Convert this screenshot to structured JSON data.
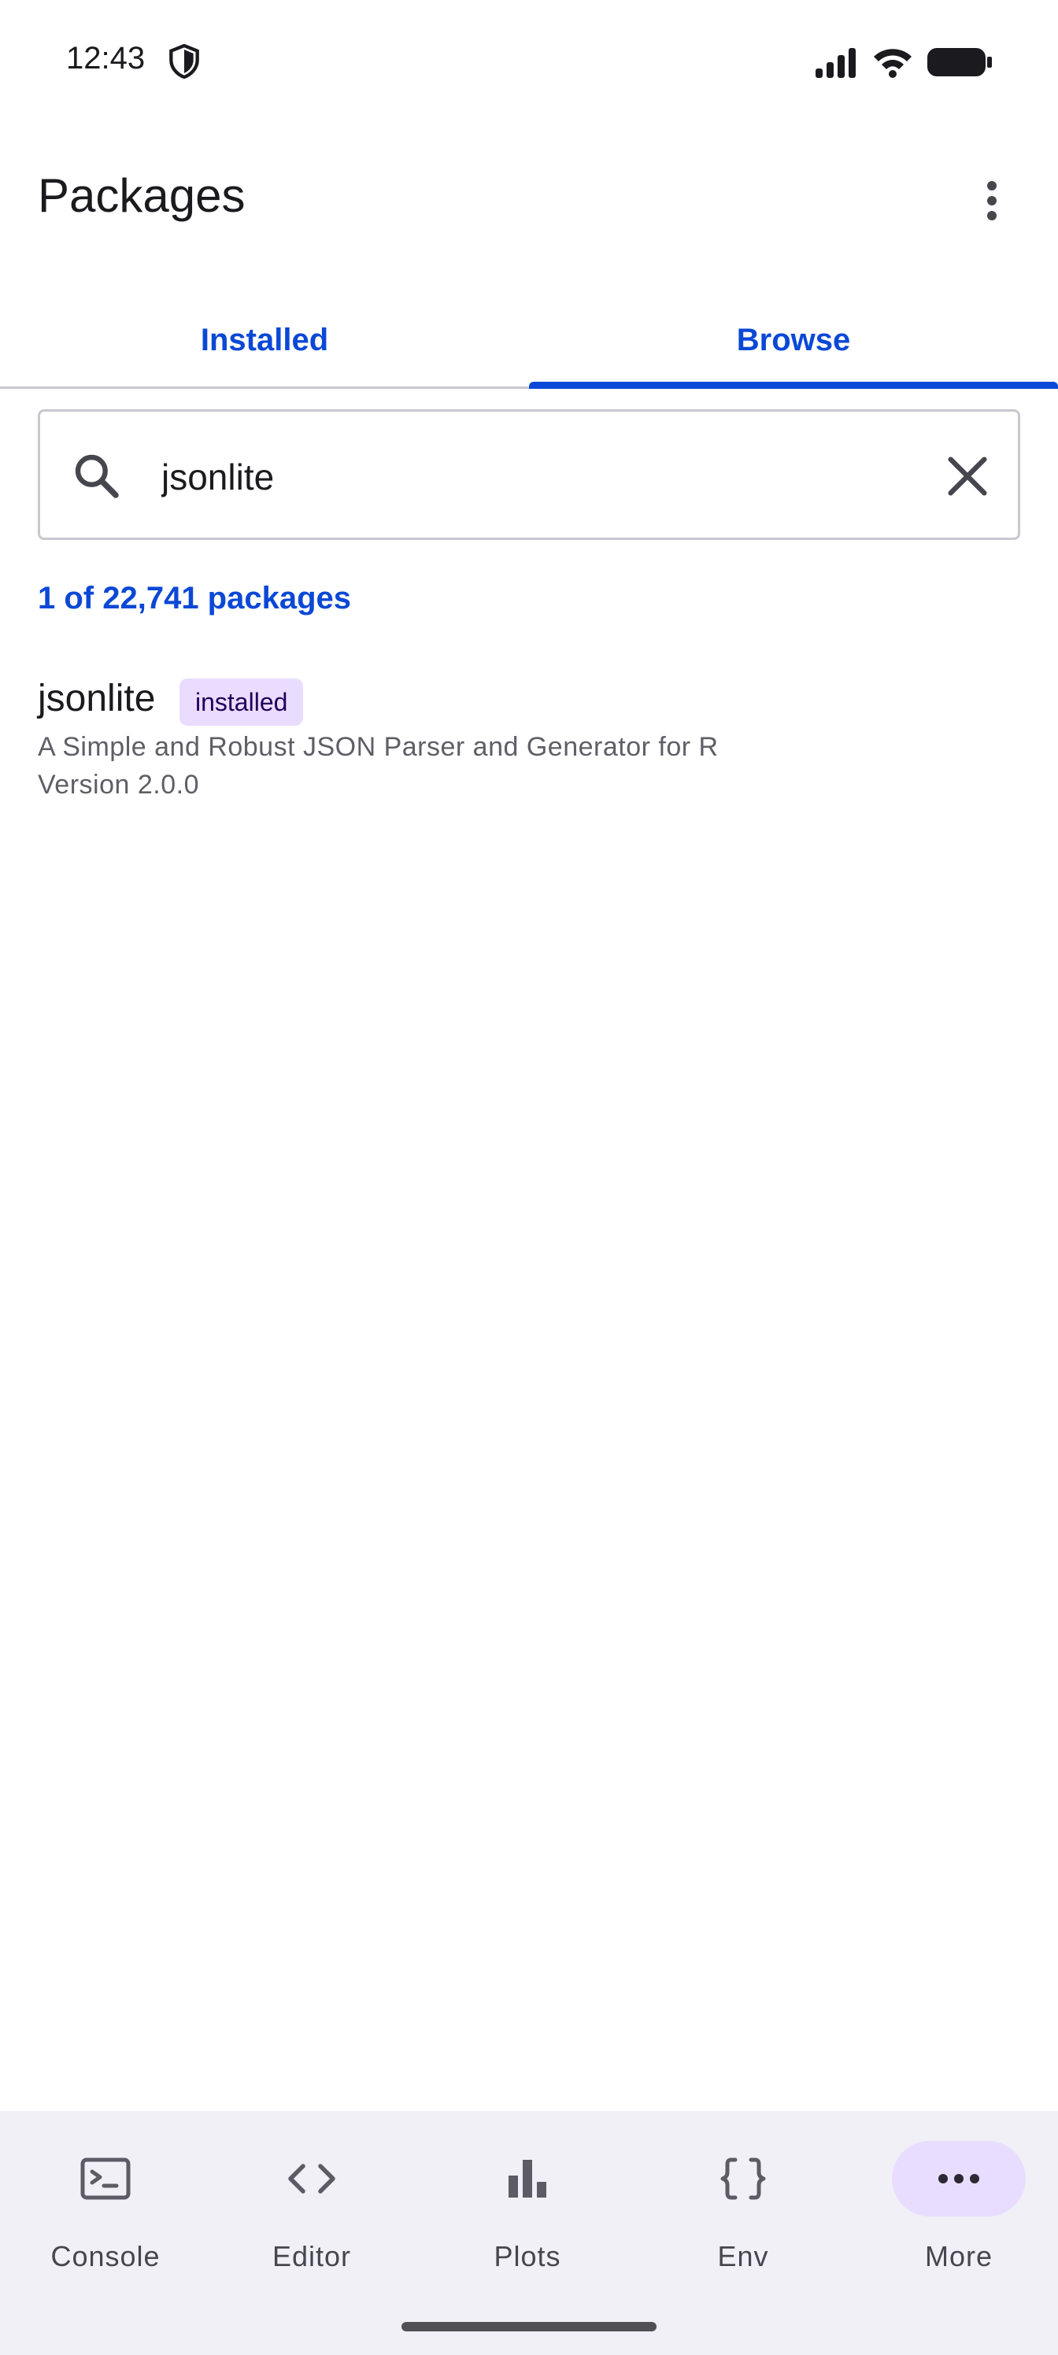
{
  "status_bar": {
    "time": "12:43"
  },
  "header": {
    "title": "Packages"
  },
  "tabs": [
    {
      "label": "Installed",
      "selected": false
    },
    {
      "label": "Browse",
      "selected": true
    }
  ],
  "search": {
    "value": "jsonlite",
    "placeholder": ""
  },
  "results": {
    "count_text": "1 of 22,741 packages",
    "items": [
      {
        "name": "jsonlite",
        "badge": "installed",
        "description": "A Simple and Robust JSON Parser and Generator for R",
        "version": "Version 2.0.0"
      }
    ]
  },
  "bottom_nav": {
    "items": [
      {
        "label": "Console",
        "icon": "console-icon"
      },
      {
        "label": "Editor",
        "icon": "code-icon"
      },
      {
        "label": "Plots",
        "icon": "bar-chart-icon"
      },
      {
        "label": "Env",
        "icon": "braces-icon"
      },
      {
        "label": "More",
        "icon": "more-horizontal-icon",
        "active": true
      }
    ]
  },
  "colors": {
    "accent": "#0b48d6",
    "badge_bg": "#eadcff",
    "nav_bg": "#f1f0f7",
    "nav_active_pill": "#e9ddff"
  }
}
